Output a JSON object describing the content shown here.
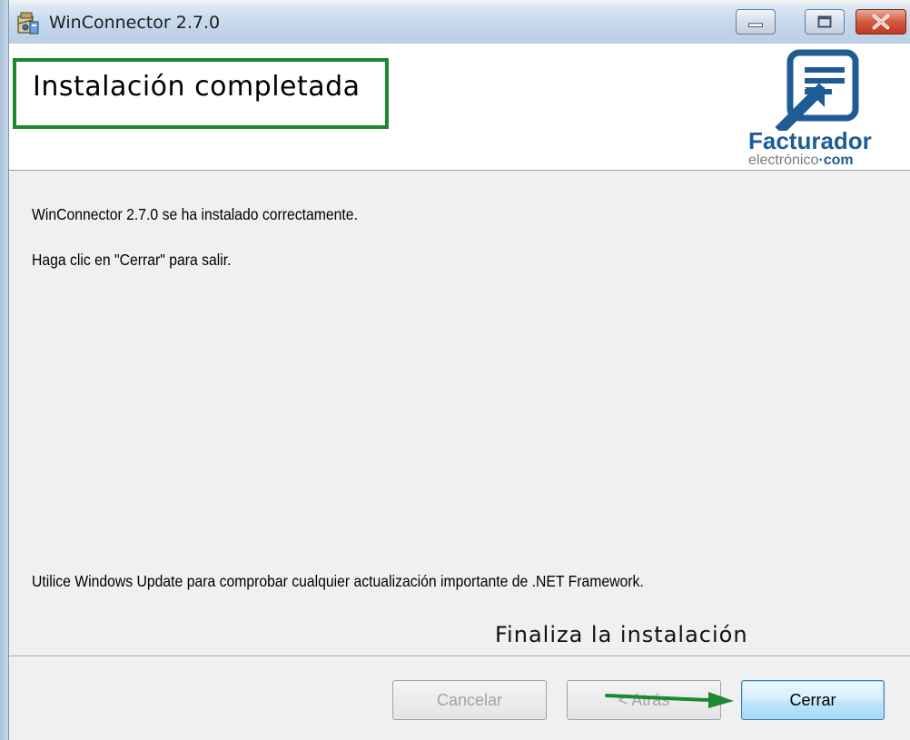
{
  "window": {
    "title": "WinConnector 2.7.0",
    "icons": [
      "installer-icon",
      "minimize-icon",
      "maximize-icon",
      "close-icon"
    ]
  },
  "header": {
    "title": "Instalación completada",
    "highlight_color": "#1b8a2e"
  },
  "logo": {
    "brand": "Facturador",
    "sub_prefix": "electrónico",
    "sub_dot": "·",
    "sub_suffix": "com",
    "brand_color": "#1f5c96"
  },
  "body": {
    "line1": "WinConnector 2.7.0 se ha instalado correctamente.",
    "line2": "Haga clic en \"Cerrar\" para salir.",
    "footer_note": "Utilice Windows Update para comprobar cualquier actualización importante de .NET Framework."
  },
  "caption": "Finaliza la instalación",
  "buttons": {
    "cancel": "Cancelar",
    "back": "< Atrás",
    "close": "Cerrar"
  },
  "annotation": {
    "arrow_color": "#1b8a2e"
  }
}
